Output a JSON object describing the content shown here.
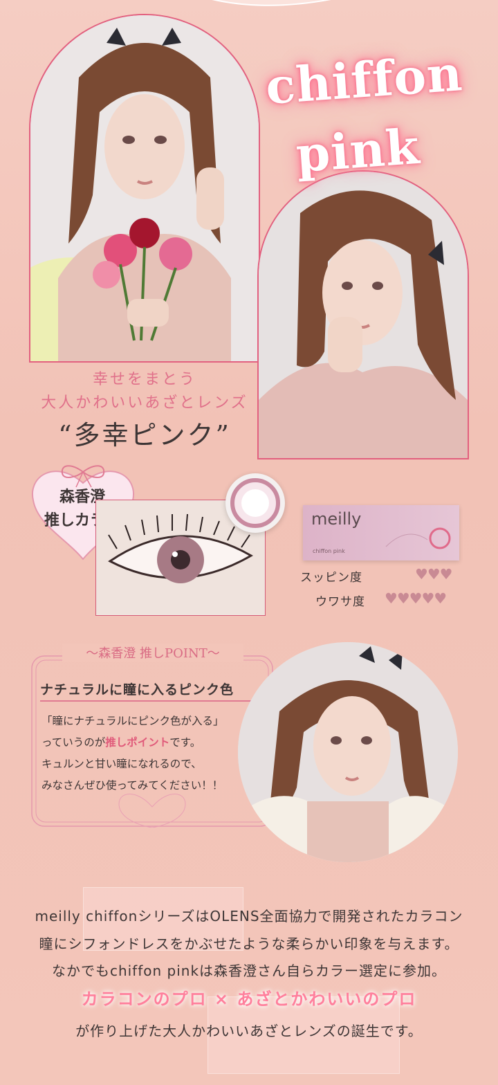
{
  "hero": {
    "title_line1": "chiffon",
    "title_line2": "pink",
    "tagline1": "幸せをまとう",
    "tagline2": "大人かわいいあざとレンズ",
    "catch": "“多幸ピンク”"
  },
  "badge": {
    "line1": "森香澄",
    "line2": "推しカラー"
  },
  "product": {
    "brand": "meilly",
    "color_name": "chiffon pink"
  },
  "ratings": [
    {
      "label": "スッピン度",
      "hearts": "♥♥♥"
    },
    {
      "label": "ウワサ度",
      "hearts": "♥♥♥♥♥"
    }
  ],
  "point": {
    "title": "～森香澄 推しPOINT～",
    "heading": "ナチュラルに瞳に入るピンク色",
    "line1": "「瞳にナチュラルにピンク色が入る」",
    "line2a": "っていうのが",
    "line2b": "推しポイント",
    "line2c": "です。",
    "line3": "キュルンと甘い瞳になれるので、",
    "line4": "みなさんぜひ使ってみてください！！"
  },
  "description": {
    "line1": "meilly chiffonシリーズはOLENS全面協力で開発されたカラコン",
    "line2": "瞳にシフォンドレスをかぶせたような柔らかい印象を与えます。",
    "line3": "なかでもchiffon  pinkは森香澄さん自らカラー選定に参加。",
    "highlight": "カラコンのプロ × あざとかわいいのプロ",
    "line4": "が作り上げた大人かわいいあざとレンズの誕生です。"
  },
  "colors": {
    "accent": "#e2607f",
    "background": "#f3c6bb",
    "text": "#3d3535",
    "heart": "#c98a94"
  }
}
